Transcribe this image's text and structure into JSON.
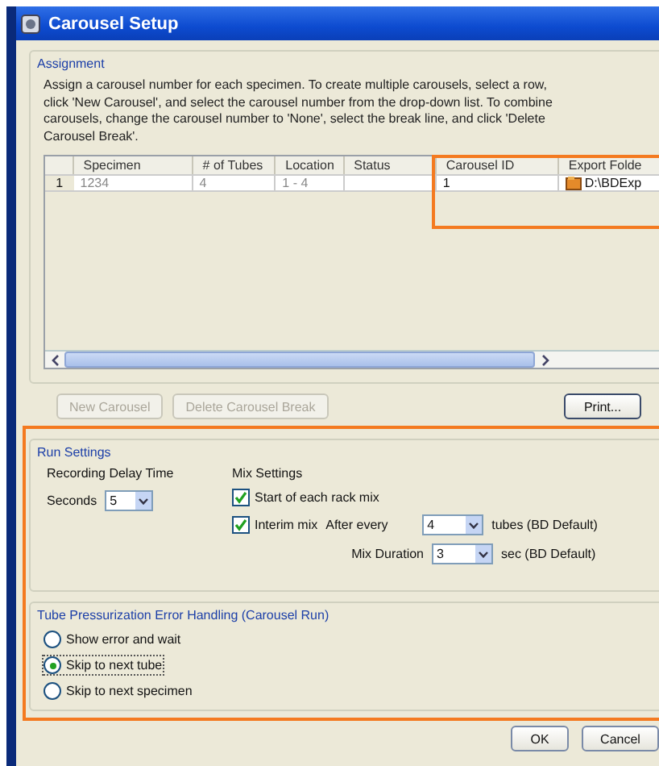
{
  "window": {
    "title": "Carousel Setup"
  },
  "assignment": {
    "legend": "Assignment",
    "description": "Assign a carousel number for each specimen. To create multiple carousels, select a row, click 'New Carousel', and select the carousel number from the drop-down list. To combine carousels, change the carousel number to 'None', select the break line, and click 'Delete Carousel Break'.",
    "table": {
      "columns": [
        "Specimen",
        "# of Tubes",
        "Location",
        "Status",
        "Carousel ID",
        "Export Folde"
      ],
      "rows": [
        {
          "number": "1",
          "cells": [
            "1234",
            "4",
            "1 - 4",
            "",
            "1",
            "D:\\BDExp"
          ]
        }
      ]
    },
    "buttons": [
      {
        "label": "New Carousel",
        "disabled": true
      },
      {
        "label": "Delete Carousel Break",
        "disabled": true
      },
      {
        "label": "Print...",
        "disabled": false
      }
    ]
  },
  "run_settings": {
    "legend": "Run Settings",
    "delay_title": "Recording Delay Time",
    "seconds_label": "Seconds",
    "seconds_value": "5",
    "mix_title": "Mix Settings",
    "start_mix": {
      "label": "Start of each rack mix",
      "checked": true
    },
    "interim_mix": {
      "label": "Interim mix",
      "checked": true
    },
    "after_every_label": "After every",
    "after_every_value": "4",
    "after_every_unit": "tubes (BD Default)",
    "duration_label": "Mix Duration",
    "duration_value": "3",
    "duration_unit": "sec (BD Default)"
  },
  "error_handling": {
    "legend": "Tube Pressurization Error Handling (Carousel Run)",
    "options": [
      {
        "label": "Show error and wait",
        "selected": false
      },
      {
        "label": "Skip to next tube",
        "selected": true
      },
      {
        "label": "Skip to next specimen",
        "selected": false
      }
    ]
  },
  "buttons": [
    "OK",
    "Cancel"
  ]
}
